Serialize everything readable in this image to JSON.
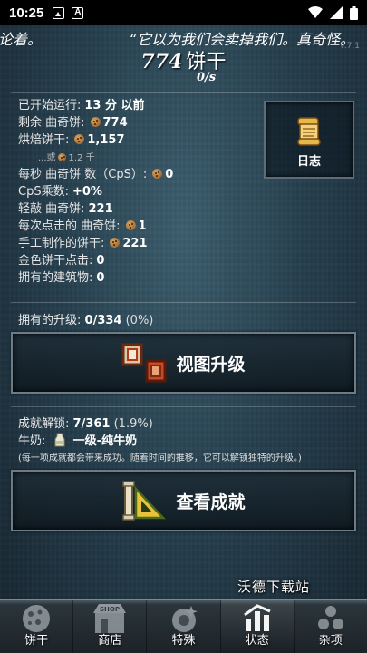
{
  "statusbar": {
    "time": "10:25"
  },
  "news": {
    "left_fragment": "论着。",
    "quote": "“它以为我们会卖掉我们。真奇怪。",
    "version": "v.7.1"
  },
  "header": {
    "cookies": "774",
    "cookies_label": "饼干",
    "rate": "0/s"
  },
  "stats": {
    "rows": [
      {
        "label": "已开始运行:",
        "value": "13 分 以前",
        "cookie": false
      },
      {
        "label": "剩余 曲奇饼:",
        "value": "774",
        "cookie": true
      },
      {
        "label": "烘焙饼干:",
        "value": "1,157",
        "cookie": true
      },
      {
        "sub": "...或",
        "value": "1.2 千",
        "cookie": true,
        "is_sub": true
      },
      {
        "label": "每秒 曲奇饼 数（CpS）:",
        "value": "0",
        "cookie": true
      },
      {
        "label": "CpS乘数:",
        "value": "+0%",
        "cookie": false
      },
      {
        "label": "轻敲 曲奇饼:",
        "value": "221",
        "cookie": false
      },
      {
        "label": "每次点击的 曲奇饼:",
        "value": "1",
        "cookie": true
      },
      {
        "label": "手工制作的饼干:",
        "value": "221",
        "cookie": true
      },
      {
        "label": "金色饼干点击:",
        "value": "0",
        "cookie": false
      },
      {
        "label": "拥有的建筑物:",
        "value": "0",
        "cookie": false
      }
    ]
  },
  "log_button": {
    "label": "日志",
    "icon": "scroll-icon"
  },
  "upgrades": {
    "label": "拥有的升级:",
    "value": "0/334",
    "pct": "(0%)",
    "button_label": "视图升级"
  },
  "achievements": {
    "label": "成就解锁:",
    "value": "7/361",
    "pct": "(1.9%)",
    "milk_label": "牛奶:",
    "milk_value": "一级-纯牛奶",
    "note": "(每一项成就都会带来成功。随着时间的推移，它可以解锁独特的升级。)",
    "button_label": "查看成就"
  },
  "watermark": "沃德下载站",
  "tabs": [
    {
      "label": "饼干",
      "icon": "cookie-icon",
      "active": false
    },
    {
      "label": "商店",
      "icon": "shop-icon",
      "active": false
    },
    {
      "label": "特殊",
      "icon": "special-icon",
      "active": false
    },
    {
      "label": "状态",
      "icon": "stats-icon",
      "active": true
    },
    {
      "label": "杂项",
      "icon": "misc-icon",
      "active": false
    }
  ],
  "colors": {
    "accent": "#6b7c86",
    "background": "#27404f",
    "bar": "#1c2328"
  }
}
